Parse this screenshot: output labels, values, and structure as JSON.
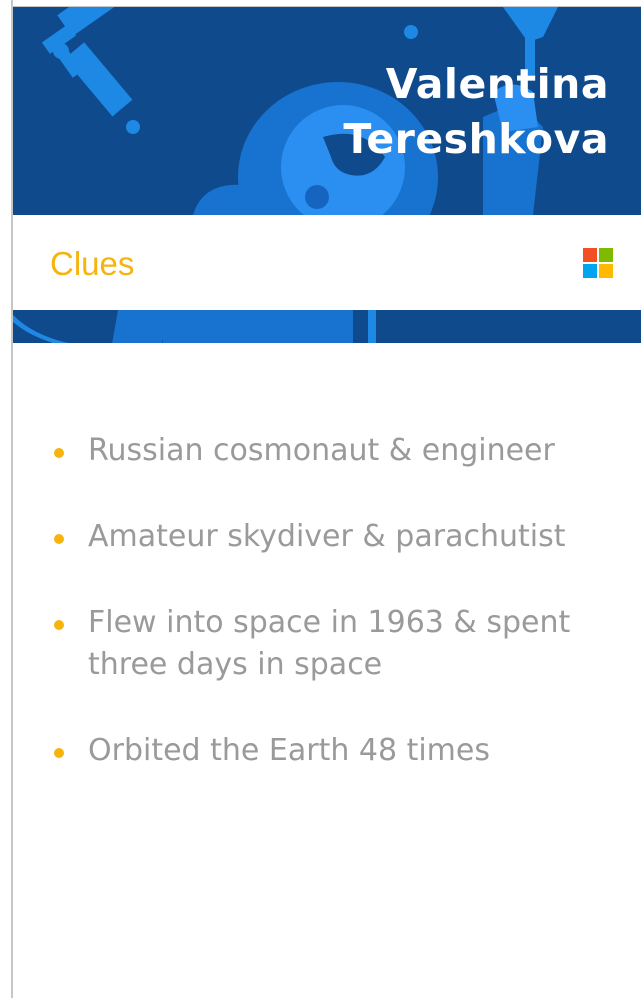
{
  "header": {
    "title_line1": "Valentina",
    "title_line2": "Tereshkova"
  },
  "clues_bar": {
    "label": "Clues",
    "logo_icon": "microsoft-logo-icon"
  },
  "clues": [
    {
      "text": "Russian cosmonaut & engineer"
    },
    {
      "text": "Amateur skydiver & parachutist"
    },
    {
      "text": "Flew into space in 1963 & spent three days in space"
    },
    {
      "text": "Orbited the Earth 48 times"
    }
  ],
  "colors": {
    "hero_dark_blue": "#0e4a8c",
    "hero_light_blue": "#1e88e5",
    "accent_yellow": "#f6b40e",
    "clue_text_gray": "#9a9a9a",
    "ms_red": "#f25022",
    "ms_green": "#7fba00",
    "ms_blue": "#00a4ef",
    "ms_yellow": "#ffb900"
  }
}
